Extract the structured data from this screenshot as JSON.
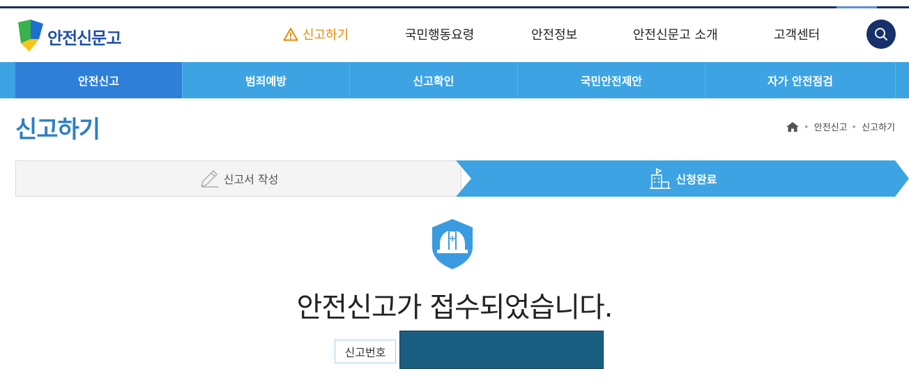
{
  "logo": {
    "text": "안전신문고"
  },
  "gnb": {
    "items": [
      "신고하기",
      "국민행동요령",
      "안전정보",
      "안전신문고 소개",
      "고객센터"
    ]
  },
  "subnav": {
    "items": [
      "안전신고",
      "범죄예방",
      "신고확인",
      "국민안전제안",
      "자가 안전점검"
    ]
  },
  "page": {
    "title": "신고하기",
    "breadcrumb": [
      "안전신고",
      "신고하기"
    ]
  },
  "steps": {
    "step1": "신고서 작성",
    "step2": "신청완료"
  },
  "result": {
    "message": "안전신고가 접수되었습니다.",
    "receipt_label": "신고번호",
    "receipt_value": ""
  },
  "colors": {
    "brand_navy": "#17306a",
    "subnav_blue": "#3da3e3",
    "active_blue": "#2d7fd8",
    "alert_orange": "#e58a00",
    "title_blue": "#2d7fc6"
  }
}
